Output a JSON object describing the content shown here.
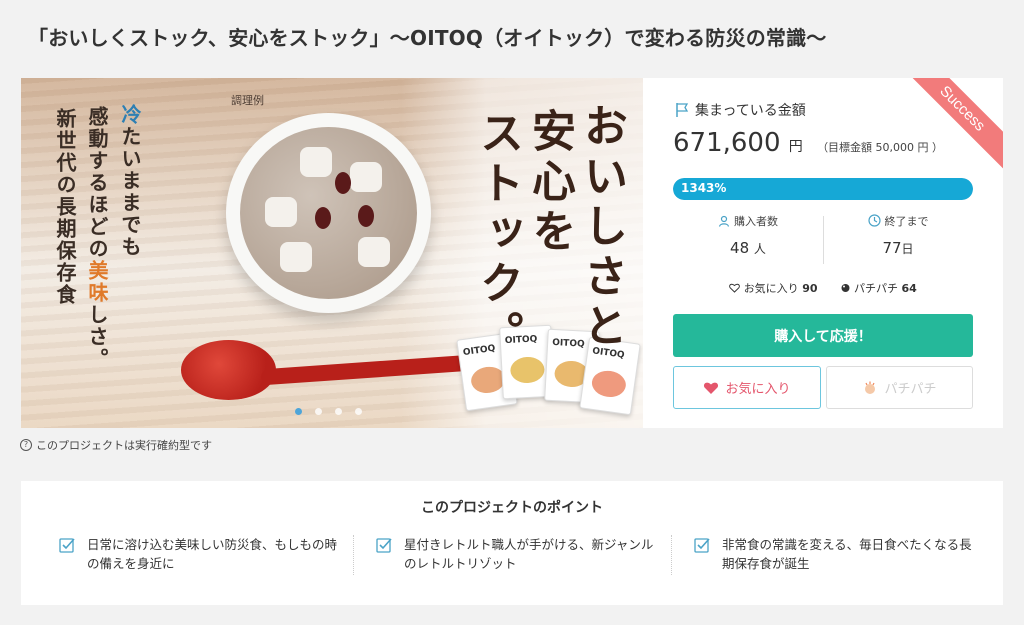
{
  "page_title": "「おいしくストック、安心をストック」〜OITOQ（オイトック）で変わる防災の常識〜",
  "hero": {
    "cooking_label": "調理例",
    "copy_col_1": "新世代の長期保存食",
    "copy_col_2_a": "感動するほどの",
    "copy_col_2_b": "美味",
    "copy_col_2_c": "しさ。",
    "copy_col_3_a": "冷",
    "copy_col_3_b": "たいままでも",
    "tagline_1": "おいしさと",
    "tagline_2": "安心を",
    "tagline_3": "ストック。",
    "pack_brand": "OITOQ",
    "carousel_dots": 4,
    "active_dot": 0
  },
  "panel": {
    "ribbon": "Success",
    "collected_label": "集まっている金額",
    "amount": "671,600",
    "amount_unit": "円",
    "target": "（目標金額 50,000 円 ）",
    "progress_text": "1343%",
    "progress_fill": 1.0,
    "buyers_label": "購入者数",
    "buyers_value": "48",
    "buyers_unit": "人",
    "days_label": "終了まで",
    "days_value": "77",
    "days_unit": "日",
    "favorite_label": "お気に入り",
    "favorite_count": "90",
    "pachi_label": "パチパチ",
    "pachi_count": "64",
    "buy_button": "購入して応援！",
    "fav_button": "お気に入り",
    "pachi_button": "パチパチ"
  },
  "exec_note": "このプロジェクトは実行確約型です",
  "points": {
    "title": "このプロジェクトのポイント",
    "items": [
      {
        "text": "日常に溶け込む美味しい防災食、もしもの時の備えを身近に"
      },
      {
        "text": "星付きレトルト職人が手がける、新ジャンルのレトルトリゾット"
      },
      {
        "text": "非常食の常識を変える、毎日食べたくなる長期保存食が誕生"
      }
    ]
  },
  "colors": {
    "accent_green": "#25b89a",
    "progress_blue": "#16a8d6",
    "ribbon_red": "#f27b7b",
    "heart": "#e4566c"
  }
}
